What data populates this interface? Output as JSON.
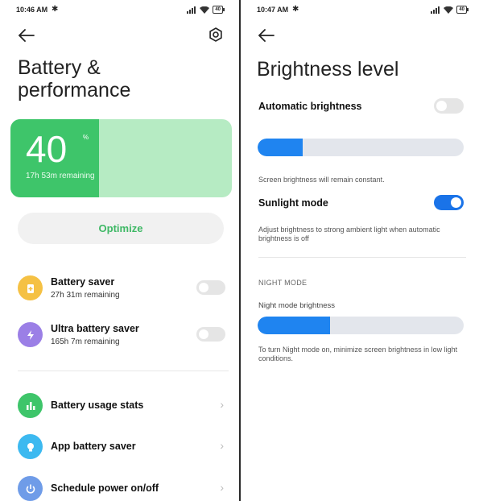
{
  "left": {
    "status": {
      "time": "10:46 AM",
      "battery": "40"
    },
    "title": "Battery & performance",
    "battery": {
      "percent": "40",
      "percent_symbol": "%",
      "remaining": "17h 53m remaining",
      "level": 0.4
    },
    "optimize_label": "Optimize",
    "toggles": [
      {
        "title": "Battery saver",
        "subtitle": "27h 31m remaining",
        "on": false,
        "icon": "battery-plus-icon",
        "color": "#f5c144"
      },
      {
        "title": "Ultra battery saver",
        "subtitle": "165h 7m remaining",
        "on": false,
        "icon": "lightning-icon",
        "color": "#9b7fe6"
      }
    ],
    "links": [
      {
        "title": "Battery usage stats",
        "icon": "bar-chart-icon",
        "color": "#3ec56a"
      },
      {
        "title": "App battery saver",
        "icon": "lightbulb-icon",
        "color": "#3cb9f0"
      },
      {
        "title": "Schedule power on/off",
        "icon": "power-icon",
        "color": "#6f9ce8"
      }
    ]
  },
  "right": {
    "status": {
      "time": "10:47 AM",
      "battery": "40"
    },
    "title": "Brightness level",
    "auto_brightness_label": "Automatic brightness",
    "auto_brightness_on": false,
    "brightness_level": 0.22,
    "brightness_note": "Screen brightness will remain constant.",
    "sunlight_label": "Sunlight mode",
    "sunlight_on": true,
    "sunlight_note": "Adjust brightness to strong ambient light when automatic brightness is off",
    "night_section": "NIGHT MODE",
    "night_brightness_label": "Night mode brightness",
    "night_level": 0.35,
    "night_note": "To turn Night mode on, minimize screen brightness in low light conditions."
  },
  "colors": {
    "battery_green": "#3ec56a",
    "battery_light": "#b6ebc3",
    "accent_blue": "#1f84f0"
  }
}
